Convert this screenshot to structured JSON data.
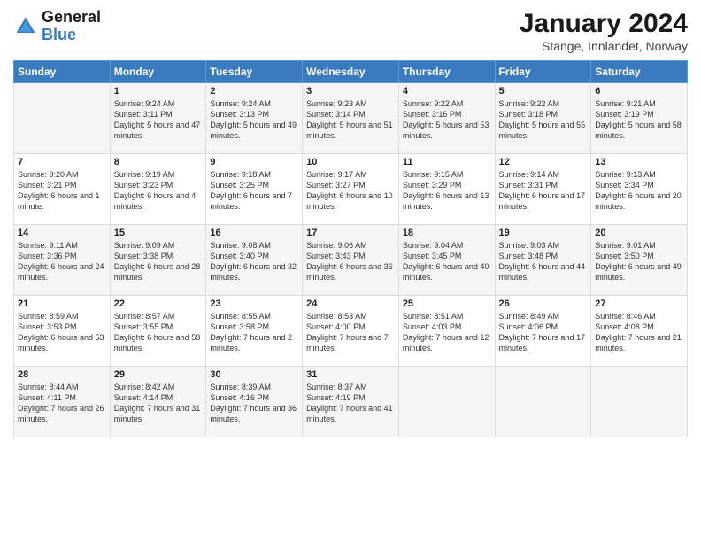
{
  "logo": {
    "line1": "General",
    "line2": "Blue"
  },
  "title": "January 2024",
  "subtitle": "Stange, Innlandet, Norway",
  "weekdays": [
    "Sunday",
    "Monday",
    "Tuesday",
    "Wednesday",
    "Thursday",
    "Friday",
    "Saturday"
  ],
  "weeks": [
    [
      {
        "day": "",
        "sunrise": "",
        "sunset": "",
        "daylight": ""
      },
      {
        "day": "1",
        "sunrise": "Sunrise: 9:24 AM",
        "sunset": "Sunset: 3:11 PM",
        "daylight": "Daylight: 5 hours and 47 minutes."
      },
      {
        "day": "2",
        "sunrise": "Sunrise: 9:24 AM",
        "sunset": "Sunset: 3:13 PM",
        "daylight": "Daylight: 5 hours and 49 minutes."
      },
      {
        "day": "3",
        "sunrise": "Sunrise: 9:23 AM",
        "sunset": "Sunset: 3:14 PM",
        "daylight": "Daylight: 5 hours and 51 minutes."
      },
      {
        "day": "4",
        "sunrise": "Sunrise: 9:22 AM",
        "sunset": "Sunset: 3:16 PM",
        "daylight": "Daylight: 5 hours and 53 minutes."
      },
      {
        "day": "5",
        "sunrise": "Sunrise: 9:22 AM",
        "sunset": "Sunset: 3:18 PM",
        "daylight": "Daylight: 5 hours and 55 minutes."
      },
      {
        "day": "6",
        "sunrise": "Sunrise: 9:21 AM",
        "sunset": "Sunset: 3:19 PM",
        "daylight": "Daylight: 5 hours and 58 minutes."
      }
    ],
    [
      {
        "day": "7",
        "sunrise": "Sunrise: 9:20 AM",
        "sunset": "Sunset: 3:21 PM",
        "daylight": "Daylight: 6 hours and 1 minute."
      },
      {
        "day": "8",
        "sunrise": "Sunrise: 9:19 AM",
        "sunset": "Sunset: 3:23 PM",
        "daylight": "Daylight: 6 hours and 4 minutes."
      },
      {
        "day": "9",
        "sunrise": "Sunrise: 9:18 AM",
        "sunset": "Sunset: 3:25 PM",
        "daylight": "Daylight: 6 hours and 7 minutes."
      },
      {
        "day": "10",
        "sunrise": "Sunrise: 9:17 AM",
        "sunset": "Sunset: 3:27 PM",
        "daylight": "Daylight: 6 hours and 10 minutes."
      },
      {
        "day": "11",
        "sunrise": "Sunrise: 9:15 AM",
        "sunset": "Sunset: 3:29 PM",
        "daylight": "Daylight: 6 hours and 13 minutes."
      },
      {
        "day": "12",
        "sunrise": "Sunrise: 9:14 AM",
        "sunset": "Sunset: 3:31 PM",
        "daylight": "Daylight: 6 hours and 17 minutes."
      },
      {
        "day": "13",
        "sunrise": "Sunrise: 9:13 AM",
        "sunset": "Sunset: 3:34 PM",
        "daylight": "Daylight: 6 hours and 20 minutes."
      }
    ],
    [
      {
        "day": "14",
        "sunrise": "Sunrise: 9:11 AM",
        "sunset": "Sunset: 3:36 PM",
        "daylight": "Daylight: 6 hours and 24 minutes."
      },
      {
        "day": "15",
        "sunrise": "Sunrise: 9:09 AM",
        "sunset": "Sunset: 3:38 PM",
        "daylight": "Daylight: 6 hours and 28 minutes."
      },
      {
        "day": "16",
        "sunrise": "Sunrise: 9:08 AM",
        "sunset": "Sunset: 3:40 PM",
        "daylight": "Daylight: 6 hours and 32 minutes."
      },
      {
        "day": "17",
        "sunrise": "Sunrise: 9:06 AM",
        "sunset": "Sunset: 3:43 PM",
        "daylight": "Daylight: 6 hours and 36 minutes."
      },
      {
        "day": "18",
        "sunrise": "Sunrise: 9:04 AM",
        "sunset": "Sunset: 3:45 PM",
        "daylight": "Daylight: 6 hours and 40 minutes."
      },
      {
        "day": "19",
        "sunrise": "Sunrise: 9:03 AM",
        "sunset": "Sunset: 3:48 PM",
        "daylight": "Daylight: 6 hours and 44 minutes."
      },
      {
        "day": "20",
        "sunrise": "Sunrise: 9:01 AM",
        "sunset": "Sunset: 3:50 PM",
        "daylight": "Daylight: 6 hours and 49 minutes."
      }
    ],
    [
      {
        "day": "21",
        "sunrise": "Sunrise: 8:59 AM",
        "sunset": "Sunset: 3:53 PM",
        "daylight": "Daylight: 6 hours and 53 minutes."
      },
      {
        "day": "22",
        "sunrise": "Sunrise: 8:57 AM",
        "sunset": "Sunset: 3:55 PM",
        "daylight": "Daylight: 6 hours and 58 minutes."
      },
      {
        "day": "23",
        "sunrise": "Sunrise: 8:55 AM",
        "sunset": "Sunset: 3:58 PM",
        "daylight": "Daylight: 7 hours and 2 minutes."
      },
      {
        "day": "24",
        "sunrise": "Sunrise: 8:53 AM",
        "sunset": "Sunset: 4:00 PM",
        "daylight": "Daylight: 7 hours and 7 minutes."
      },
      {
        "day": "25",
        "sunrise": "Sunrise: 8:51 AM",
        "sunset": "Sunset: 4:03 PM",
        "daylight": "Daylight: 7 hours and 12 minutes."
      },
      {
        "day": "26",
        "sunrise": "Sunrise: 8:49 AM",
        "sunset": "Sunset: 4:06 PM",
        "daylight": "Daylight: 7 hours and 17 minutes."
      },
      {
        "day": "27",
        "sunrise": "Sunrise: 8:46 AM",
        "sunset": "Sunset: 4:08 PM",
        "daylight": "Daylight: 7 hours and 21 minutes."
      }
    ],
    [
      {
        "day": "28",
        "sunrise": "Sunrise: 8:44 AM",
        "sunset": "Sunset: 4:11 PM",
        "daylight": "Daylight: 7 hours and 26 minutes."
      },
      {
        "day": "29",
        "sunrise": "Sunrise: 8:42 AM",
        "sunset": "Sunset: 4:14 PM",
        "daylight": "Daylight: 7 hours and 31 minutes."
      },
      {
        "day": "30",
        "sunrise": "Sunrise: 8:39 AM",
        "sunset": "Sunset: 4:16 PM",
        "daylight": "Daylight: 7 hours and 36 minutes."
      },
      {
        "day": "31",
        "sunrise": "Sunrise: 8:37 AM",
        "sunset": "Sunset: 4:19 PM",
        "daylight": "Daylight: 7 hours and 41 minutes."
      },
      {
        "day": "",
        "sunrise": "",
        "sunset": "",
        "daylight": ""
      },
      {
        "day": "",
        "sunrise": "",
        "sunset": "",
        "daylight": ""
      },
      {
        "day": "",
        "sunrise": "",
        "sunset": "",
        "daylight": ""
      }
    ]
  ]
}
